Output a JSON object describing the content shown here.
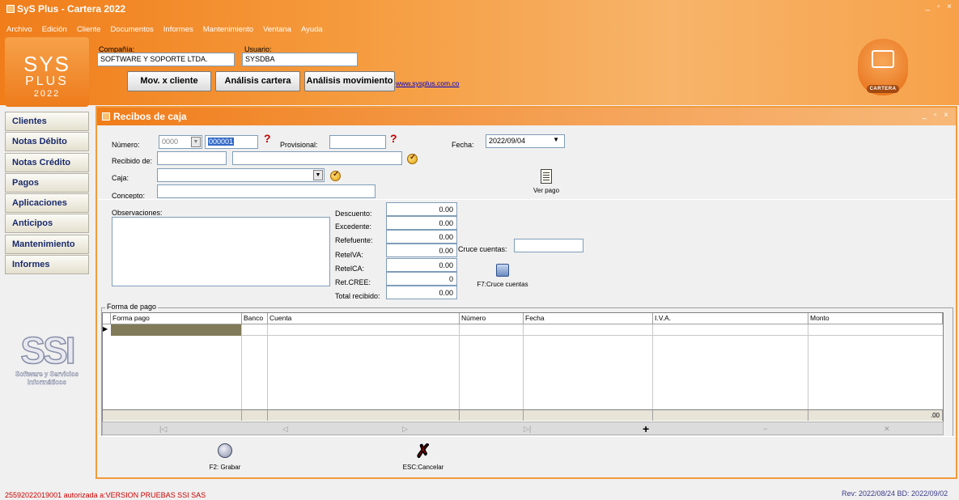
{
  "app": {
    "title": "SyS Plus - Cartera 2022",
    "window_controls": "_ ▫ ×"
  },
  "menu": [
    "Archivo",
    "Edición",
    "Cliente",
    "Documentos",
    "Informes",
    "Mantenimiento",
    "Ventana",
    "Ayuda"
  ],
  "logo": {
    "line1": "SYS",
    "line2": "PLUS",
    "line3": "2022"
  },
  "header": {
    "company_label": "Compañía:",
    "company_value": "SOFTWARE Y SOPORTE LTDA.",
    "user_label": "Usuario:",
    "user_value": "SYSDBA",
    "buttons": [
      "Mov. x cliente",
      "Análisis cartera",
      "Análisis movimiento"
    ],
    "link": "www.sysplus.com.co",
    "cartera_label": "CARTERA"
  },
  "sidebar": {
    "items": [
      "Clientes",
      "Notas Débito",
      "Notas Crédito",
      "Pagos",
      "Aplicaciones",
      "Anticipos",
      "Mantenimiento",
      "Informes"
    ]
  },
  "brand": {
    "name": "SSI",
    "tagline1": "Software y Servicios",
    "tagline2": "Informáticos"
  },
  "form": {
    "title": "Recibos de caja",
    "window_controls": "_ ▫ ×",
    "numero_label": "Número:",
    "numero_prefix": "0000",
    "numero_value": "000001",
    "provisional_label": "Provisional:",
    "provisional_value": "",
    "fecha_label": "Fecha:",
    "fecha_value": "2022/09/04",
    "recibido_label": "Recibido de:",
    "recibido_code": "",
    "recibido_name": "",
    "caja_label": "Caja:",
    "caja_value": "",
    "concepto_label": "Concepto:",
    "concepto_value": "",
    "ver_pago_label": "Ver pago",
    "observaciones_label": "Observaciones:",
    "observaciones_value": "",
    "amounts": [
      {
        "label": "Descuento:",
        "value": "0.00"
      },
      {
        "label": "Excedente:",
        "value": "0.00"
      },
      {
        "label": "Refefuente:",
        "value": "0.00"
      },
      {
        "label": "RetelVA:",
        "value": "0.00"
      },
      {
        "label": "RetelCA:",
        "value": "0.00"
      },
      {
        "label": "Ret.CREE:",
        "value": "0"
      },
      {
        "label": "Total recibido:",
        "value": "0.00"
      }
    ],
    "cruce_label": "Cruce cuentas:",
    "cruce_value": "",
    "cruce_button": "F7:Cruce cuentas",
    "grid": {
      "title": "Forma de pago",
      "columns": [
        "Forma pago",
        "Banco",
        "Cuenta",
        "Número",
        "Fecha",
        "I.V.A.",
        "Monto"
      ],
      "footer_total": ".00"
    },
    "save_label": "F2: Grabar",
    "cancel_label": "ESC:Cancelar"
  },
  "footer": {
    "license": "25592022019001 autorizada a:VERSION PRUEBAS SSI SAS",
    "revision": "Rev: 2022/08/24 BD: 2022/09/02"
  }
}
